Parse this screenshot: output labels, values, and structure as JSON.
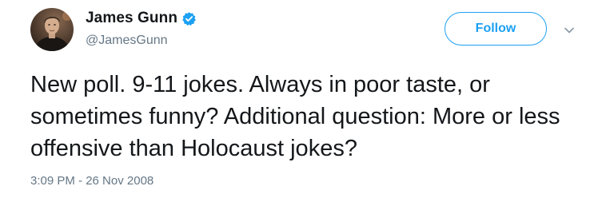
{
  "author": {
    "display_name": "James Gunn",
    "handle": "@JamesGunn",
    "verified": true
  },
  "follow_button": {
    "label": "Follow"
  },
  "tweet": {
    "text": "New poll. 9-11 jokes. Always in poor taste, or sometimes funny?  Additional question: More or less offensive than Holocaust jokes?",
    "timestamp": "3:09 PM - 26 Nov 2008"
  },
  "icons": {
    "verified": "verified-badge-icon",
    "menu": "chevron-down-icon",
    "avatar": "profile-photo"
  },
  "colors": {
    "accent": "#1da1f2",
    "text_primary": "#14171a",
    "text_secondary": "#657786",
    "background": "#ffffff"
  }
}
